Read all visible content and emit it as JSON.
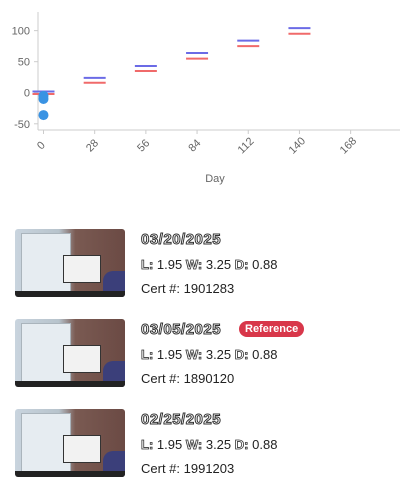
{
  "chart_data": {
    "type": "line",
    "xlabel": "Day",
    "ylabel": "",
    "x_ticks": [
      0,
      28,
      56,
      84,
      112,
      140,
      168
    ],
    "y_ticks": [
      100,
      50,
      0,
      -50
    ],
    "xlim": [
      -3,
      195
    ],
    "ylim": [
      -60,
      130
    ],
    "grid": false,
    "legend": "none",
    "series": [
      {
        "color": "#6b6be6",
        "style": "dash",
        "points": [
          [
            0,
            2
          ],
          [
            28,
            24
          ],
          [
            56,
            43
          ],
          [
            84,
            64
          ],
          [
            112,
            84
          ],
          [
            140,
            104
          ]
        ]
      },
      {
        "color": "#f06a6a",
        "style": "dash",
        "points": [
          [
            0,
            -2
          ],
          [
            28,
            16
          ],
          [
            56,
            35
          ],
          [
            84,
            55
          ],
          [
            112,
            75
          ],
          [
            140,
            95
          ]
        ]
      },
      {
        "color": "#3a93e3",
        "style": "dot",
        "points": [
          [
            0,
            -5
          ],
          [
            0,
            -10
          ],
          [
            0,
            -36
          ]
        ]
      }
    ]
  },
  "entries": [
    {
      "date": "03/20/2025",
      "l_label": "L:",
      "l": "1.95",
      "w_label": "W:",
      "w": "3.25",
      "d_label": "D:",
      "d": "0.88",
      "cert_label": "Cert #:",
      "cert": "1901283",
      "badge": ""
    },
    {
      "date": "03/05/2025",
      "l_label": "L:",
      "l": "1.95",
      "w_label": "W:",
      "w": "3.25",
      "d_label": "D:",
      "d": "0.88",
      "cert_label": "Cert #:",
      "cert": "1890120",
      "badge": "Reference"
    },
    {
      "date": "02/25/2025",
      "l_label": "L:",
      "l": "1.95",
      "w_label": "W:",
      "w": "3.25",
      "d_label": "D:",
      "d": "0.88",
      "cert_label": "Cert #:",
      "cert": "1991203",
      "badge": ""
    }
  ],
  "colors": {
    "badge": "#d8374a",
    "accent": "#3a93e3"
  }
}
